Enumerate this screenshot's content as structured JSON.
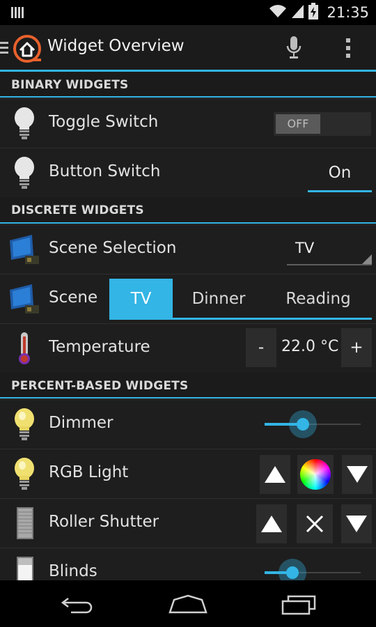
{
  "status": {
    "time": "21:35"
  },
  "app": {
    "title": "Widget Overview"
  },
  "sections": {
    "binary": "BINARY WIDGETS",
    "discrete": "DISCRETE WIDGETS",
    "percent": "PERCENT-BASED WIDGETS"
  },
  "rows": {
    "toggle": {
      "label": "Toggle Switch",
      "state": "OFF"
    },
    "button": {
      "label": "Button Switch",
      "value": "On"
    },
    "scene_selection": {
      "label": "Scene Selection",
      "selected": "TV"
    },
    "scene": {
      "label": "Scene",
      "options": [
        "TV",
        "Dinner",
        "Reading"
      ],
      "selected_index": 0
    },
    "temperature": {
      "label": "Temperature",
      "minus": "-",
      "value": "22.0 °C",
      "plus": "+"
    },
    "dimmer": {
      "label": "Dimmer",
      "level_percent": 40
    },
    "rgb": {
      "label": "RGB Light"
    },
    "roller": {
      "label": "Roller Shutter"
    },
    "blinds": {
      "label": "Blinds",
      "level_percent": 29
    }
  },
  "colors": {
    "accent": "#33b5e5",
    "background": "#1b1b1b"
  },
  "icons": {
    "status": [
      "notification-icon",
      "wifi-icon",
      "signal-icon",
      "battery-charging-icon"
    ],
    "actionbar": [
      "drawer-menu-icon",
      "openhab-logo-icon",
      "microphone-icon",
      "overflow-menu-icon"
    ],
    "nav": [
      "back-icon",
      "home-icon",
      "recent-apps-icon"
    ]
  }
}
